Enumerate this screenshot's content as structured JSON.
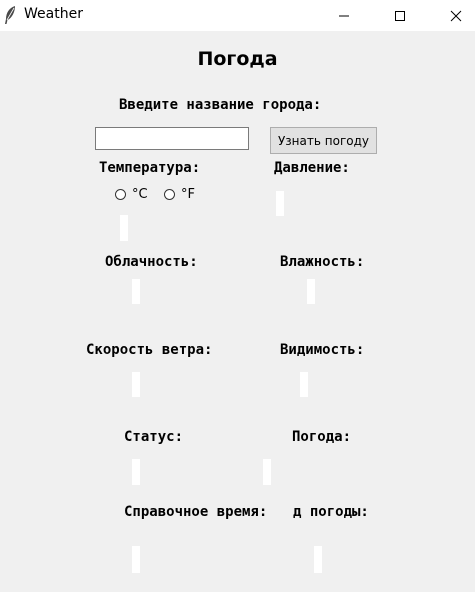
{
  "window": {
    "title": "Weather",
    "app_icon": "feather-icon",
    "controls": {
      "minimize": "minimize-icon",
      "maximize": "maximize-icon",
      "close": "close-icon"
    }
  },
  "main": {
    "heading": "Погода",
    "city_prompt": "Введите название города:",
    "city_input": {
      "value": "",
      "placeholder": ""
    },
    "fetch_button": "Узнать погоду",
    "temperature_label": "Температура:",
    "unit_celsius": "°C",
    "unit_fahrenheit": "°F",
    "pressure_label": "Давление:",
    "cloudiness_label": "Облачность:",
    "humidity_label": "Влажность:",
    "wind_label": "Скорость ветра:",
    "visibility_label": "Видимость:",
    "status_label": "Статус:",
    "weather_label": "Погода:",
    "reference_time_label": "Справочное время:",
    "weather_code_label_visible": "д погоды:"
  },
  "colors": {
    "window_bg": "#f0f0f0",
    "titlebar_bg": "#ffffff",
    "value_field_bg": "#ffffff",
    "button_bg": "#e1e1e1"
  }
}
